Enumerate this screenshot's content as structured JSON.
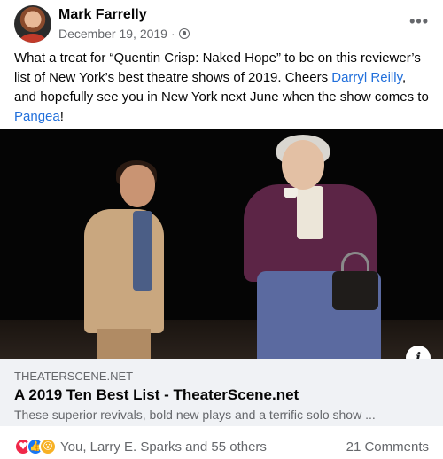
{
  "post": {
    "author": "Mark Farrelly",
    "date": "December 19, 2019",
    "separator": "·",
    "more_label": "•••",
    "text_parts": {
      "before_link1": "What a treat for “Quentin Crisp: Naked Hope” to be on this reviewer’s list of New York’s best theatre shows of 2019. Cheers ",
      "link1": "Darryl Reilly",
      "between": ", and hopefully see you in New York next June when the show comes to ",
      "link2": "Pangea",
      "after": "!"
    }
  },
  "link_card": {
    "domain": "THEATERSCENE.NET",
    "title": "A 2019 Ten Best List - TheaterScene.net",
    "description": "These superior revivals, bold new plays and a terrific solo show ...",
    "info_label": "i"
  },
  "footer": {
    "reaction_icons": [
      "love-icon",
      "like-icon",
      "wow-icon"
    ],
    "reaction_glyphs": {
      "love": "♥",
      "like": "👍",
      "wow": "😮"
    },
    "reactions_text": "You, Larry E. Sparks and 55 others",
    "comments_text": "21 Comments"
  },
  "colors": {
    "link": "#216fdb",
    "secondary_text": "#65676b",
    "card_bg": "#f0f2f5"
  }
}
